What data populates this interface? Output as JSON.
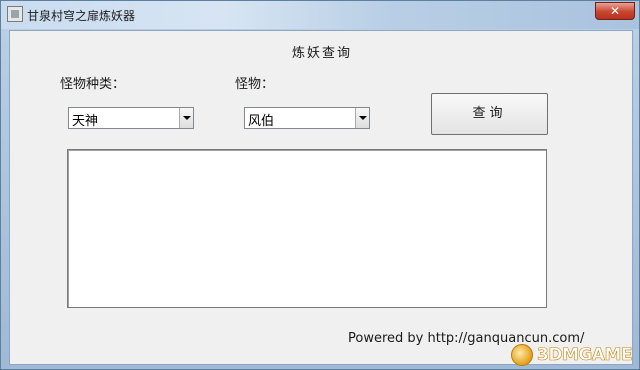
{
  "window": {
    "title": "甘泉村穹之扉炼妖器",
    "close_glyph": "✕"
  },
  "main": {
    "heading": "炼妖查询",
    "monster_type_label": "怪物种类：",
    "monster_label": "怪物：",
    "monster_type_select": {
      "value": "天神"
    },
    "monster_select": {
      "value": "风伯"
    },
    "query_button": "查询",
    "result_text": ""
  },
  "footer": {
    "powered_by": "Powered by http://ganquancun.com/"
  },
  "watermark": {
    "text": "3DMGAME"
  },
  "colors": {
    "client_bg": "#f0f0f0",
    "close_red": "#c9452f",
    "frame_blue": "#9fb9d6"
  }
}
